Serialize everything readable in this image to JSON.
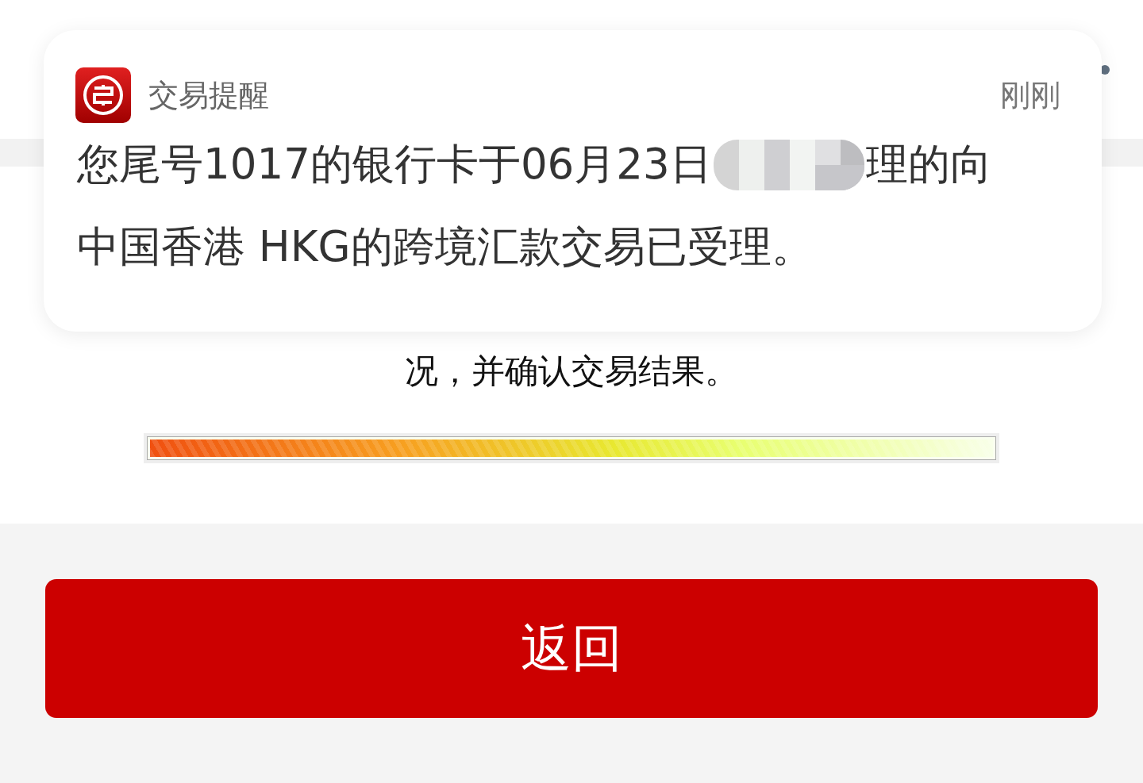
{
  "notification": {
    "app": "交易提醒",
    "time": "刚刚",
    "line1_start": "您尾号1017的银行卡于06月23日",
    "line1_end": "理的向",
    "line2": "中国香港 HKG的跨境汇款交易已受理。"
  },
  "page": {
    "note": "况，并确认交易结果。",
    "progress": {
      "level": 1
    }
  },
  "buttons": [
    {
      "label": "返回",
      "kind": "primary"
    }
  ]
}
